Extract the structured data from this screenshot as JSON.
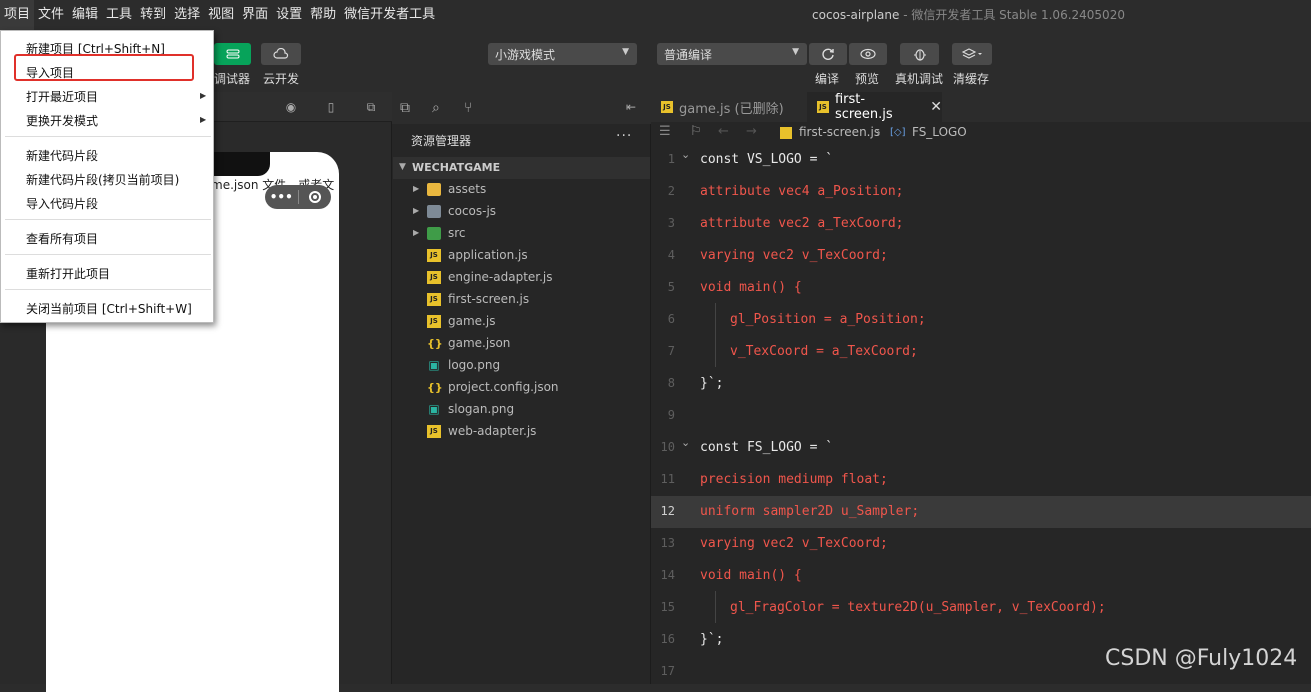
{
  "menubar": {
    "items": [
      "项目",
      "文件",
      "编辑",
      "工具",
      "转到",
      "选择",
      "视图",
      "界面",
      "设置",
      "帮助",
      "微信开发者工具"
    ],
    "window_title": "cocos-airplane",
    "window_subtitle": "- 微信开发者工具 Stable 1.06.2405020"
  },
  "toolbar": {
    "debugger_label": "调试器",
    "cloud_label": "云开发",
    "mode_select": "小游戏模式",
    "compile_select": "普通编译",
    "compile_label": "编译",
    "preview_label": "预览",
    "device_debug_label": "真机调试",
    "clear_cache_label": "清缓存"
  },
  "dropdown": {
    "items": [
      {
        "label": "新建项目  [Ctrl+Shift+N]"
      },
      {
        "label": "导入项目"
      },
      {
        "label": "打开最近项目"
      },
      {
        "label": "更换开发模式"
      },
      {
        "label": "新建代码片段"
      },
      {
        "label": "新建代码片段(拷贝当前项目)"
      },
      {
        "label": "导入代码片段"
      },
      {
        "label": "查看所有项目"
      },
      {
        "label": "重新打开此项目"
      },
      {
        "label": "关闭当前项目  [Ctrl+Shift+W]"
      }
    ]
  },
  "simulator": {
    "phone_text": "me.json 文件，或者文"
  },
  "explorer": {
    "title": "资源管理器",
    "root": "WECHATGAME",
    "files": [
      {
        "name": "assets",
        "icon": "folder-icon"
      },
      {
        "name": "cocos-js",
        "icon": "folder-icon"
      },
      {
        "name": "src",
        "icon": "folder-icon"
      },
      {
        "name": "application.js",
        "icon": "js-file-icon"
      },
      {
        "name": "engine-adapter.js",
        "icon": "js-file-icon"
      },
      {
        "name": "first-screen.js",
        "icon": "js-file-icon"
      },
      {
        "name": "game.js",
        "icon": "js-file-icon"
      },
      {
        "name": "game.json",
        "icon": "json-file-icon"
      },
      {
        "name": "logo.png",
        "icon": "image-file-icon"
      },
      {
        "name": "project.config.json",
        "icon": "json-file-icon"
      },
      {
        "name": "slogan.png",
        "icon": "image-file-icon"
      },
      {
        "name": "web-adapter.js",
        "icon": "js-file-icon"
      }
    ]
  },
  "editor": {
    "tabs": [
      {
        "label": "game.js (已删除)"
      },
      {
        "label": "first-screen.js"
      }
    ],
    "breadcrumb_file": "first-screen.js",
    "breadcrumb_symbol": "FS_LOGO",
    "current_line": 12,
    "lines": [
      {
        "num": "1",
        "code": "const VS_LOGO = `"
      },
      {
        "num": "2",
        "code": "attribute vec4 a_Position;"
      },
      {
        "num": "3",
        "code": "attribute vec2 a_TexCoord;"
      },
      {
        "num": "4",
        "code": "varying vec2 v_TexCoord;"
      },
      {
        "num": "5",
        "code": "void main() {"
      },
      {
        "num": "6",
        "code": "gl_Position = a_Position;"
      },
      {
        "num": "7",
        "code": "v_TexCoord = a_TexCoord;"
      },
      {
        "num": "8",
        "code": "}`;"
      },
      {
        "num": "9",
        "code": ""
      },
      {
        "num": "10",
        "code": "const FS_LOGO = `"
      },
      {
        "num": "11",
        "code": "precision mediump float;"
      },
      {
        "num": "12",
        "code": "uniform sampler2D u_Sampler;"
      },
      {
        "num": "13",
        "code": "varying vec2 v_TexCoord;"
      },
      {
        "num": "14",
        "code": "void main() {"
      },
      {
        "num": "15",
        "code": "gl_FragColor = texture2D(u_Sampler, v_TexCoord);"
      },
      {
        "num": "16",
        "code": "}`;"
      },
      {
        "num": "17",
        "code": ""
      }
    ]
  },
  "watermark": "CSDN @Fuly1024",
  "colors": {
    "highlight_border": "#e0302a",
    "code_red": "#f0564c",
    "accent_green": "#07a35a"
  }
}
